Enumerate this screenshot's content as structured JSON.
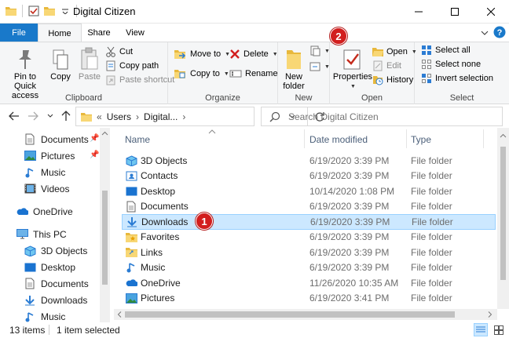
{
  "window": {
    "title": "Digital Citizen",
    "minimize": "—",
    "maximize": "☐",
    "close": "✕"
  },
  "ribbon_tabs": {
    "file": "File",
    "home": "Home",
    "share": "Share",
    "view": "View"
  },
  "ribbon": {
    "clipboard": {
      "label": "Clipboard",
      "pin_to_quick_access": [
        "Pin to Quick",
        "access"
      ],
      "copy": "Copy",
      "paste": "Paste",
      "cut": "Cut",
      "copy_path": "Copy path",
      "paste_shortcut": "Paste shortcut"
    },
    "organize": {
      "label": "Organize",
      "move_to": "Move to",
      "copy_to": "Copy to",
      "delete": "Delete",
      "rename": "Rename"
    },
    "new": {
      "label": "New",
      "new_folder": [
        "New",
        "folder"
      ]
    },
    "open": {
      "label": "Open",
      "properties": "Properties",
      "open": "Open",
      "edit": "Edit",
      "history": "History"
    },
    "select": {
      "label": "Select",
      "select_all": "Select all",
      "select_none": "Select none",
      "invert_selection": "Invert selection"
    }
  },
  "address": {
    "chevrons": "«",
    "crumb_users": "Users",
    "crumb_digital": "Digital...",
    "arrow": "›",
    "search_placeholder": "Search Digital Citizen"
  },
  "nav_pane": {
    "quick_items": [
      {
        "label": "Documents",
        "pinned": true
      },
      {
        "label": "Pictures",
        "pinned": true
      },
      {
        "label": "Music",
        "pinned": false
      },
      {
        "label": "Videos",
        "pinned": false
      }
    ],
    "onedrive": "OneDrive",
    "this_pc": "This PC",
    "pc_items": [
      "3D Objects",
      "Desktop",
      "Documents",
      "Downloads",
      "Music"
    ]
  },
  "columns": {
    "name": "Name",
    "date_modified": "Date modified",
    "type": "Type"
  },
  "files": [
    {
      "name": "3D Objects",
      "date": "6/19/2020 3:39 PM",
      "type": "File folder"
    },
    {
      "name": "Contacts",
      "date": "6/19/2020 3:39 PM",
      "type": "File folder"
    },
    {
      "name": "Desktop",
      "date": "10/14/2020 1:08 PM",
      "type": "File folder"
    },
    {
      "name": "Documents",
      "date": "6/19/2020 3:39 PM",
      "type": "File folder"
    },
    {
      "name": "Downloads",
      "date": "6/19/2020 3:39 PM",
      "type": "File folder"
    },
    {
      "name": "Favorites",
      "date": "6/19/2020 3:39 PM",
      "type": "File folder"
    },
    {
      "name": "Links",
      "date": "6/19/2020 3:39 PM",
      "type": "File folder"
    },
    {
      "name": "Music",
      "date": "6/19/2020 3:39 PM",
      "type": "File folder"
    },
    {
      "name": "OneDrive",
      "date": "11/26/2020 10:35 AM",
      "type": "File folder"
    },
    {
      "name": "Pictures",
      "date": "6/19/2020 3:41 PM",
      "type": "File folder"
    }
  ],
  "selected_index": 4,
  "status": {
    "item_count": "13 items",
    "selection": "1 item selected"
  },
  "annotations": {
    "badge_1": "1",
    "badge_2": "2"
  },
  "colors": {
    "accent": "#1979ca",
    "selection_bg": "#cce8ff",
    "badge": "#d21e1e",
    "folder_yellow": "#f8d775"
  }
}
